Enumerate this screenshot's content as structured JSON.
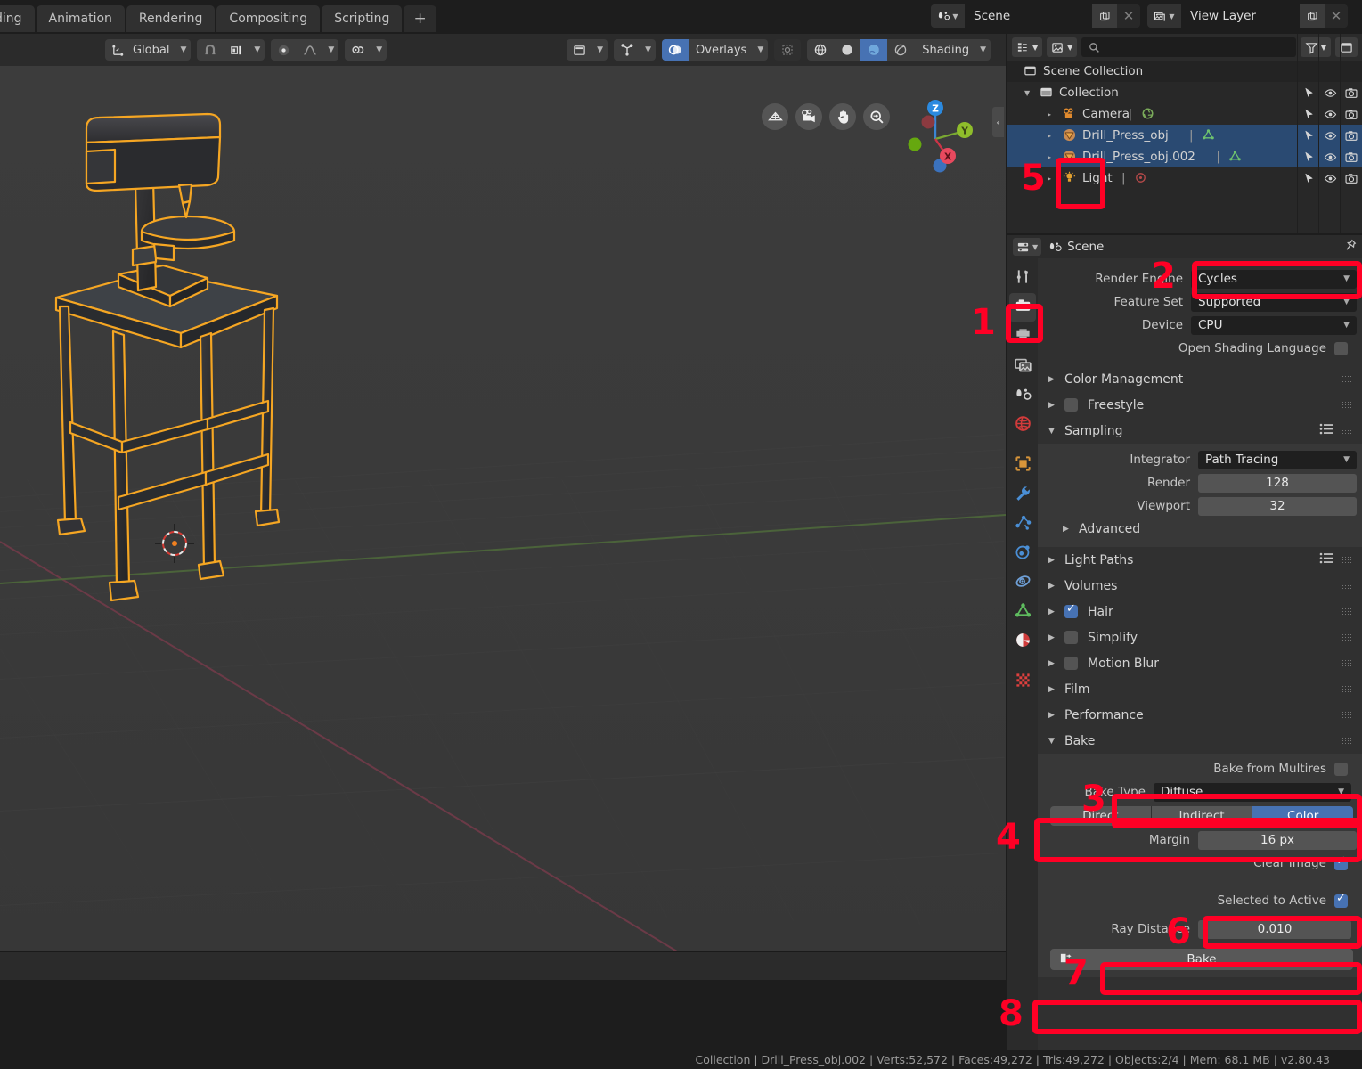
{
  "topbar": {
    "workspace_tabs": [
      {
        "label": "ding",
        "clipped": true
      },
      {
        "label": "Animation"
      },
      {
        "label": "Rendering"
      },
      {
        "label": "Compositing"
      },
      {
        "label": "Scripting"
      },
      {
        "label": "+",
        "is_add": true
      }
    ],
    "scene_field": {
      "icon": "scene-icon",
      "value": "Scene",
      "new_label": "",
      "close_label": "✕"
    },
    "viewlayer_field": {
      "icon": "viewlayer-icon",
      "value": "View Layer",
      "new_label": "",
      "close_label": "✕"
    }
  },
  "viewport": {
    "header": {
      "transform_orientation": "Global",
      "snap_icon": "magnet-icon",
      "snap_target_icon": "snap-icon",
      "proportional_icon": "proportional-edit-icon",
      "falloff_icon": "falloff-curve-icon",
      "mirror_icon": "mirror-icon",
      "view_icon": "view-object-types-icon",
      "gizmo_icon": "gizmo-icon",
      "overlays_label": "Overlays",
      "overlays_icon": "overlays-icon",
      "xray_icon": "xray-icon",
      "shading_label": "Shading",
      "shade_modes": [
        "wireframe",
        "solid",
        "material-preview",
        "rendered"
      ],
      "shade_active_index": 2
    },
    "nav_buttons": [
      "zoom-region-icon",
      "camera-view-icon",
      "hand-pan-icon",
      "zoom-icon"
    ],
    "axis_gizmo": {
      "z": "Z",
      "y": "Y",
      "x": "X"
    },
    "collapse_arrow": "‹",
    "object_outline_color": "#f5a623"
  },
  "outliner": {
    "display_mode_icon": "outliner-mode-icon",
    "filter_id_icon": "id-type-icon",
    "search_placeholder": "",
    "search_icon": "search-icon",
    "filter_icon": "filter-funnel-icon",
    "collection_icon": "collection-icon",
    "rows": [
      {
        "label": "Scene Collection",
        "indent": 18,
        "icon": "scene-collection-icon",
        "selected": false,
        "expander": "",
        "controls": false
      },
      {
        "label": "Collection",
        "indent": 36,
        "icon": "collection-icon",
        "selected": false,
        "expander": "▼",
        "controls": true
      },
      {
        "label": "Camera",
        "indent": 62,
        "icon": "camera-object-icon",
        "selected": false,
        "expander": "▸",
        "controls": true,
        "data_icon": "camera-data-icon"
      },
      {
        "label": "Drill_Press_obj",
        "indent": 62,
        "icon": "mesh-object-icon",
        "selected": true,
        "expander": "▸",
        "controls": true,
        "data_icon": "mesh-data-icon"
      },
      {
        "label": "Drill_Press_obj.002",
        "indent": 62,
        "icon": "mesh-object-icon",
        "selected": true,
        "expander": "▸",
        "controls": true,
        "data_icon": "mesh-data-icon"
      },
      {
        "label": "Light",
        "indent": 62,
        "icon": "light-object-icon",
        "selected": false,
        "expander": "▸",
        "controls": true,
        "data_icon": "light-data-icon"
      }
    ],
    "row_controls": [
      "selectable-arrow-icon",
      "hide-eye-icon",
      "render-camera-icon"
    ]
  },
  "properties": {
    "editor_icon": "properties-editor-icon",
    "breadcrumb_icon": "scene-icon",
    "breadcrumb": "Scene",
    "pin_icon": "pin-icon",
    "tabs": [
      {
        "name": "tool-tab",
        "icon": "tool-icon",
        "active": false
      },
      {
        "name": "render-tab",
        "icon": "render-camera-back-icon",
        "active": true
      },
      {
        "name": "output-tab",
        "icon": "printer-icon",
        "active": false
      },
      {
        "name": "view-layer-tab",
        "icon": "images-icon",
        "active": false
      },
      {
        "name": "scene-tab",
        "icon": "scene-cone-icon",
        "active": false
      },
      {
        "name": "world-tab",
        "icon": "world-globe-icon",
        "active": false
      },
      {
        "name": "object-tab",
        "icon": "object-square-icon",
        "active": false
      },
      {
        "name": "modifier-tab",
        "icon": "wrench-icon",
        "active": false
      },
      {
        "name": "particles-tab",
        "icon": "particles-icon",
        "active": false
      },
      {
        "name": "physics-tab",
        "icon": "physics-orbit-icon",
        "active": false
      },
      {
        "name": "constraints-tab",
        "icon": "constraint-icon",
        "active": false
      },
      {
        "name": "data-tab",
        "icon": "mesh-data-triangle-icon",
        "active": false
      },
      {
        "name": "material-tab",
        "icon": "material-sphere-icon",
        "active": false
      },
      {
        "name": "texture-tab",
        "icon": "texture-checker-icon",
        "active": false
      }
    ],
    "render_engine": {
      "label": "Render Engine",
      "value": "Cycles"
    },
    "feature_set": {
      "label": "Feature Set",
      "value": "Supported"
    },
    "device": {
      "label": "Device",
      "value": "CPU"
    },
    "osl": {
      "label": "Open Shading Language",
      "checked": false
    },
    "panels": [
      {
        "label": "Color Management",
        "open": false,
        "checkbox": null,
        "list": false
      },
      {
        "label": "Freestyle",
        "open": false,
        "checkbox": false,
        "list": false
      },
      {
        "label": "Sampling",
        "open": true,
        "checkbox": null,
        "list": true
      },
      {
        "label": "Light Paths",
        "open": false,
        "checkbox": null,
        "list": true
      },
      {
        "label": "Volumes",
        "open": false,
        "checkbox": null,
        "list": false
      },
      {
        "label": "Hair",
        "open": false,
        "checkbox": true,
        "list": false
      },
      {
        "label": "Simplify",
        "open": false,
        "checkbox": false,
        "list": false
      },
      {
        "label": "Motion Blur",
        "open": false,
        "checkbox": false,
        "list": false
      },
      {
        "label": "Film",
        "open": false,
        "checkbox": null,
        "list": false
      },
      {
        "label": "Performance",
        "open": false,
        "checkbox": null,
        "list": false
      },
      {
        "label": "Bake",
        "open": true,
        "checkbox": null,
        "list": false
      }
    ],
    "sampling": {
      "integrator": {
        "label": "Integrator",
        "value": "Path Tracing"
      },
      "render": {
        "label": "Render",
        "value": "128"
      },
      "viewport": {
        "label": "Viewport",
        "value": "32"
      },
      "advanced": {
        "label": "Advanced",
        "open": false
      }
    },
    "bake": {
      "bake_from_multires": {
        "label": "Bake from Multires",
        "checked": false
      },
      "bake_type": {
        "label": "Bake Type",
        "value": "Diffuse"
      },
      "contributions": [
        "Direct",
        "Indirect",
        "Color"
      ],
      "contributions_selected": "Color",
      "margin": {
        "label": "Margin",
        "value": "16 px"
      },
      "clear_image": {
        "label": "Clear Image",
        "checked": true
      },
      "selected_to_active": {
        "label": "Selected to Active",
        "checked": true
      },
      "ray_distance": {
        "label": "Ray Distance",
        "value": "0.010"
      },
      "bake_button": {
        "label": "Bake",
        "icon": "bake-render-icon"
      }
    }
  },
  "annotations": [
    {
      "number": "1",
      "target": "render-properties-tab"
    },
    {
      "number": "2",
      "target": "render-engine-dropdown"
    },
    {
      "number": "3",
      "target": "bake-type-dropdown"
    },
    {
      "number": "4",
      "target": "bake-contributions-toggle"
    },
    {
      "number": "5",
      "target": "outliner-mesh-objects"
    },
    {
      "number": "6",
      "target": "selected-to-active-checkbox"
    },
    {
      "number": "7",
      "target": "ray-distance-field"
    },
    {
      "number": "8",
      "target": "bake-button"
    }
  ],
  "statusbar": {
    "text": "Collection | Drill_Press_obj.002 | Verts:52,572 | Faces:49,272 | Tris:49,272 | Objects:2/4 | Mem: 68.1 MB | v2.80.43"
  }
}
